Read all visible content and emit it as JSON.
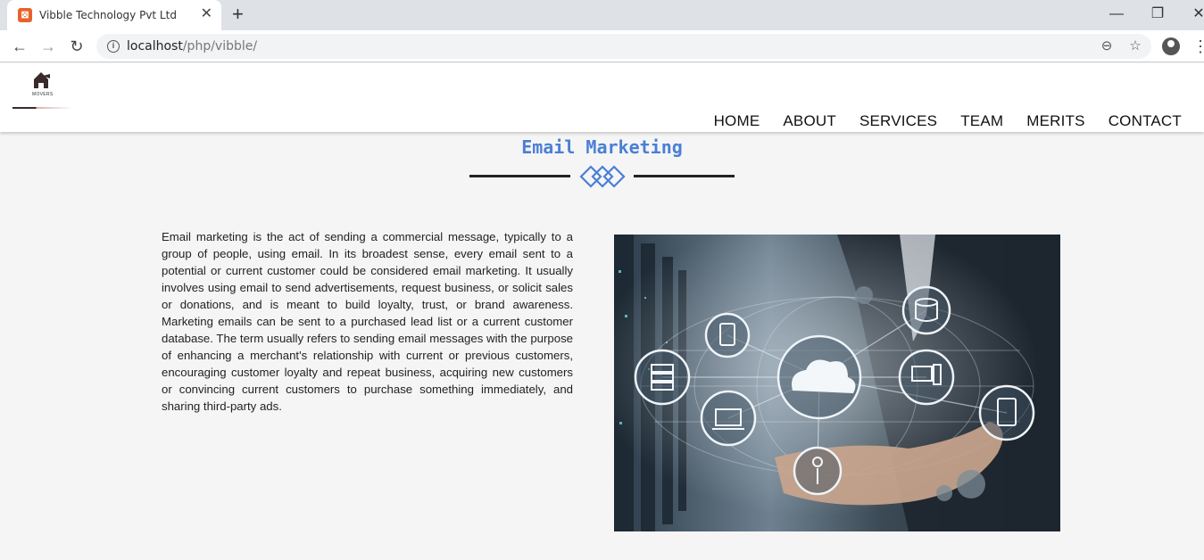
{
  "browser": {
    "tab_title": "Vibble Technology Pvt Ltd",
    "tab_close": "✕",
    "new_tab": "+",
    "url_host": "localhost",
    "url_path": "/php/vibble/",
    "window_minimize": "—",
    "window_restore": "❐",
    "window_close": "✕"
  },
  "site": {
    "logo_text": "MOVERS",
    "nav": [
      "HOME",
      "ABOUT",
      "SERVICES",
      "TEAM",
      "MERITS",
      "CONTACT"
    ]
  },
  "main": {
    "title": "Email Marketing",
    "paragraph": "Email marketing is the act of sending a commercial message, typically to a group of people, using email. In its broadest sense, every email sent to a potential or current customer could be considered email marketing. It usually involves using email to send advertisements, request business, or solicit sales or donations, and is meant to build loyalty, trust, or brand awareness. Marketing emails can be sent to a purchased lead list or a current customer database. The term usually refers to sending email messages with the purpose of enhancing a merchant's relationship with current or previous customers, encouraging customer loyalty and repeat business, acquiring new customers or convincing current customers to purchase something immediately, and sharing third-party ads."
  },
  "colors": {
    "accent": "#4a7fd6",
    "nav_text": "#111111",
    "page_bg": "#f5f5f5"
  },
  "icons": [
    "favicon-icon",
    "back-icon",
    "forward-icon",
    "reload-icon",
    "info-icon",
    "zoom-icon",
    "star-icon",
    "profile-icon",
    "menu-icon"
  ]
}
